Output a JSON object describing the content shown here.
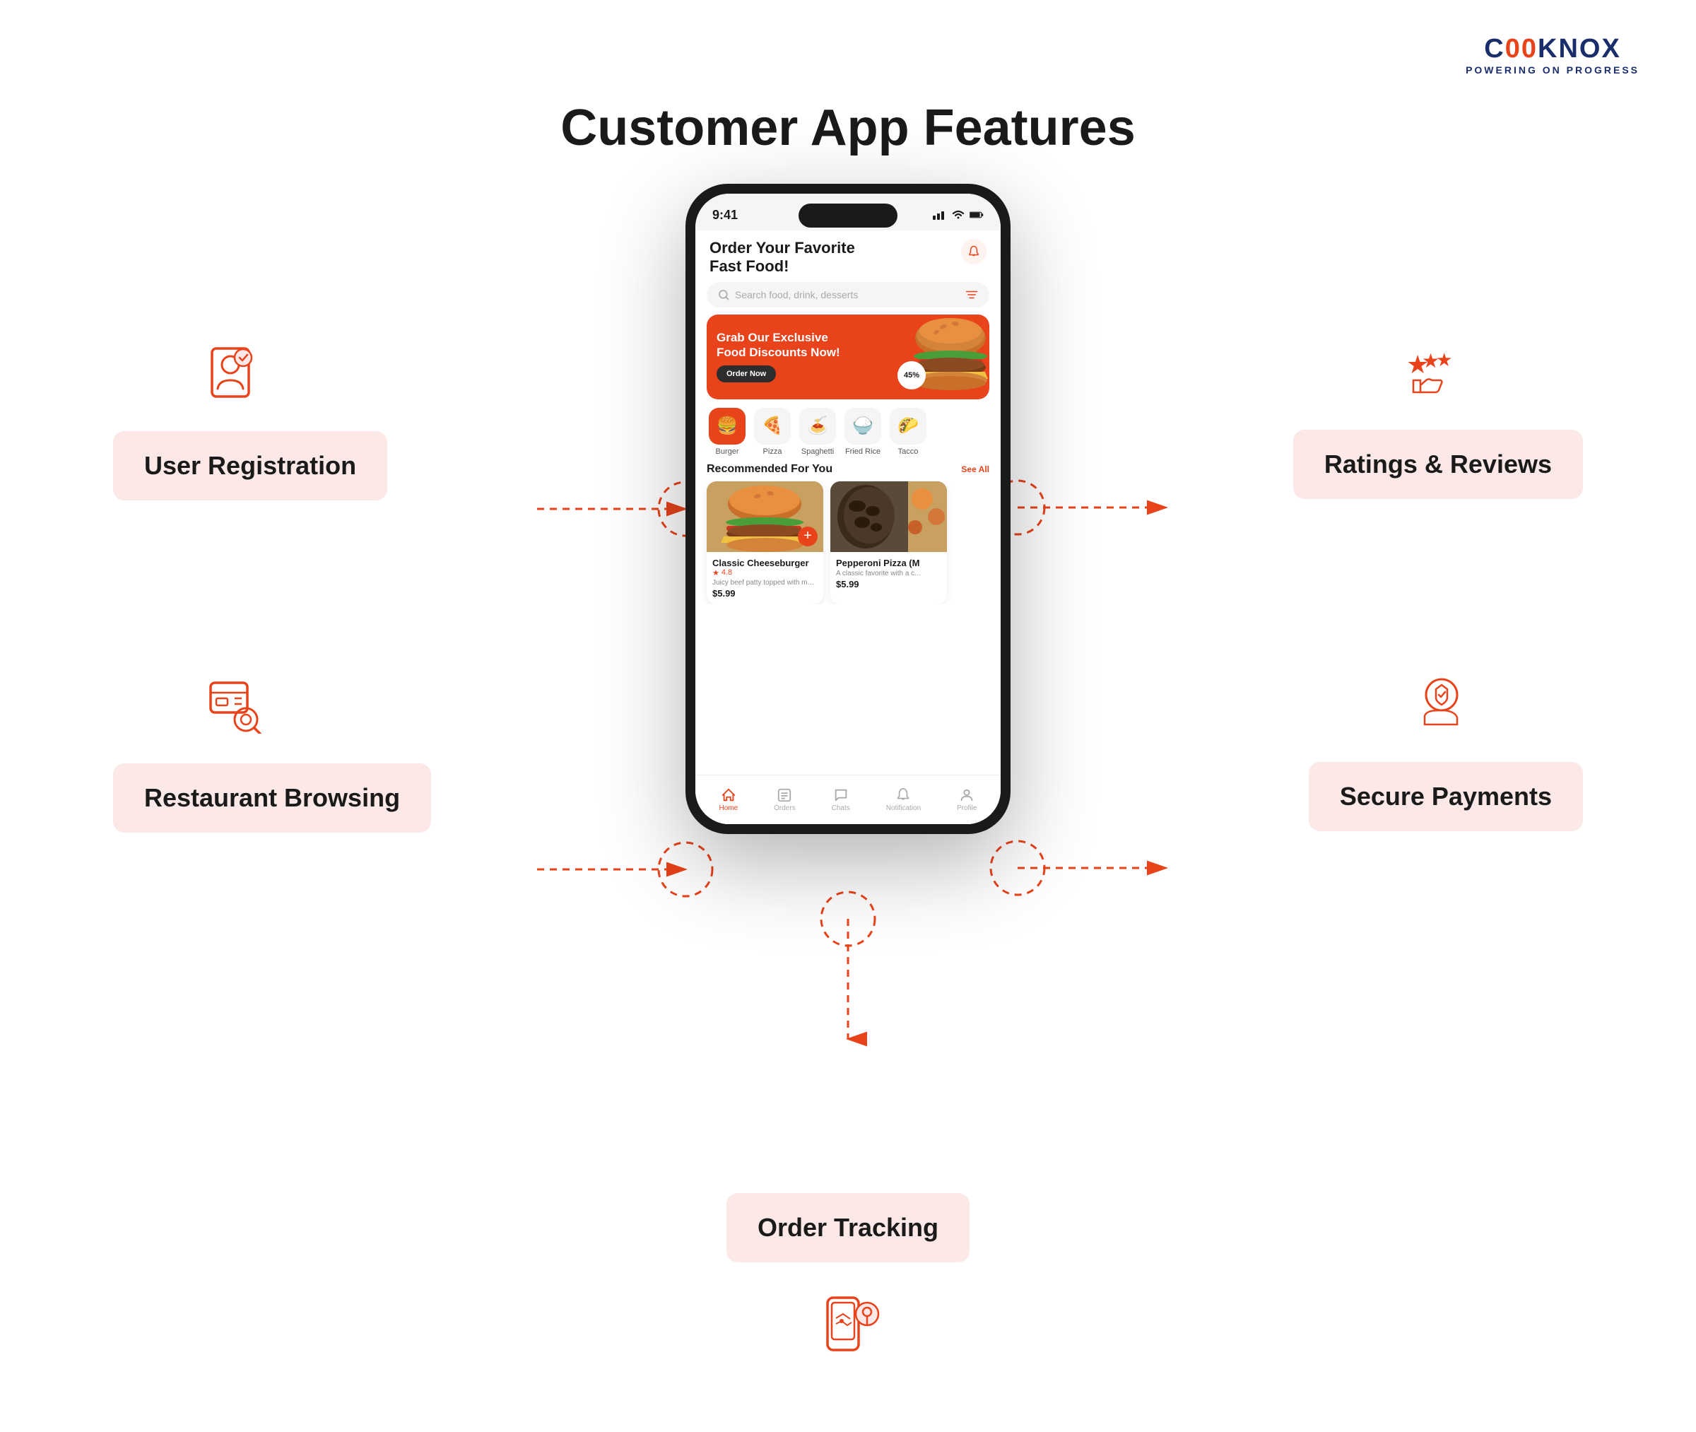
{
  "logo": {
    "name": "CODKNOX",
    "name_styled": "C00KNOX",
    "subtitle": "POWERING ON PROGRESS"
  },
  "page": {
    "title": "Customer App Features"
  },
  "features": {
    "user_registration": "User Registration",
    "ratings_reviews": "Ratings & Reviews",
    "restaurant_browsing": "Restaurant Browsing",
    "secure_payments": "Secure Payments",
    "order_tracking": "Order Tracking"
  },
  "phone": {
    "status_time": "9:41",
    "app_title_line1": "Order Your Favorite",
    "app_title_line2": "Fast Food!",
    "search_placeholder": "Search food, drink, desserts",
    "banner_title_line1": "Grab Our Exclusive",
    "banner_title_line2": "Food Discounts Now!",
    "banner_btn": "Order Now",
    "banner_badge": "45%",
    "section_title": "Recommended For You",
    "see_all": "See All",
    "categories": [
      {
        "label": "Burger",
        "emoji": "🍔",
        "active": true
      },
      {
        "label": "Pizza",
        "emoji": "🍕",
        "active": false
      },
      {
        "label": "Spaghetti",
        "emoji": "🍝",
        "active": false
      },
      {
        "label": "Fried Rice",
        "emoji": "🍚",
        "active": false
      },
      {
        "label": "Tacco",
        "emoji": "🌮",
        "active": false
      }
    ],
    "food_cards": [
      {
        "name": "Classic Cheeseburger",
        "rating": "4.8",
        "desc": "Juicy beef patty topped with melted ch...",
        "price": "$5.99"
      },
      {
        "name": "Pepperoni Pizza (M",
        "rating": "",
        "desc": "A classic favorite with a c...",
        "price": "$5.99"
      }
    ],
    "nav_items": [
      {
        "label": "Home",
        "active": true
      },
      {
        "label": "Orders",
        "active": false
      },
      {
        "label": "Chats",
        "active": false
      },
      {
        "label": "Notification",
        "active": false
      },
      {
        "label": "Profile",
        "active": false
      }
    ]
  }
}
